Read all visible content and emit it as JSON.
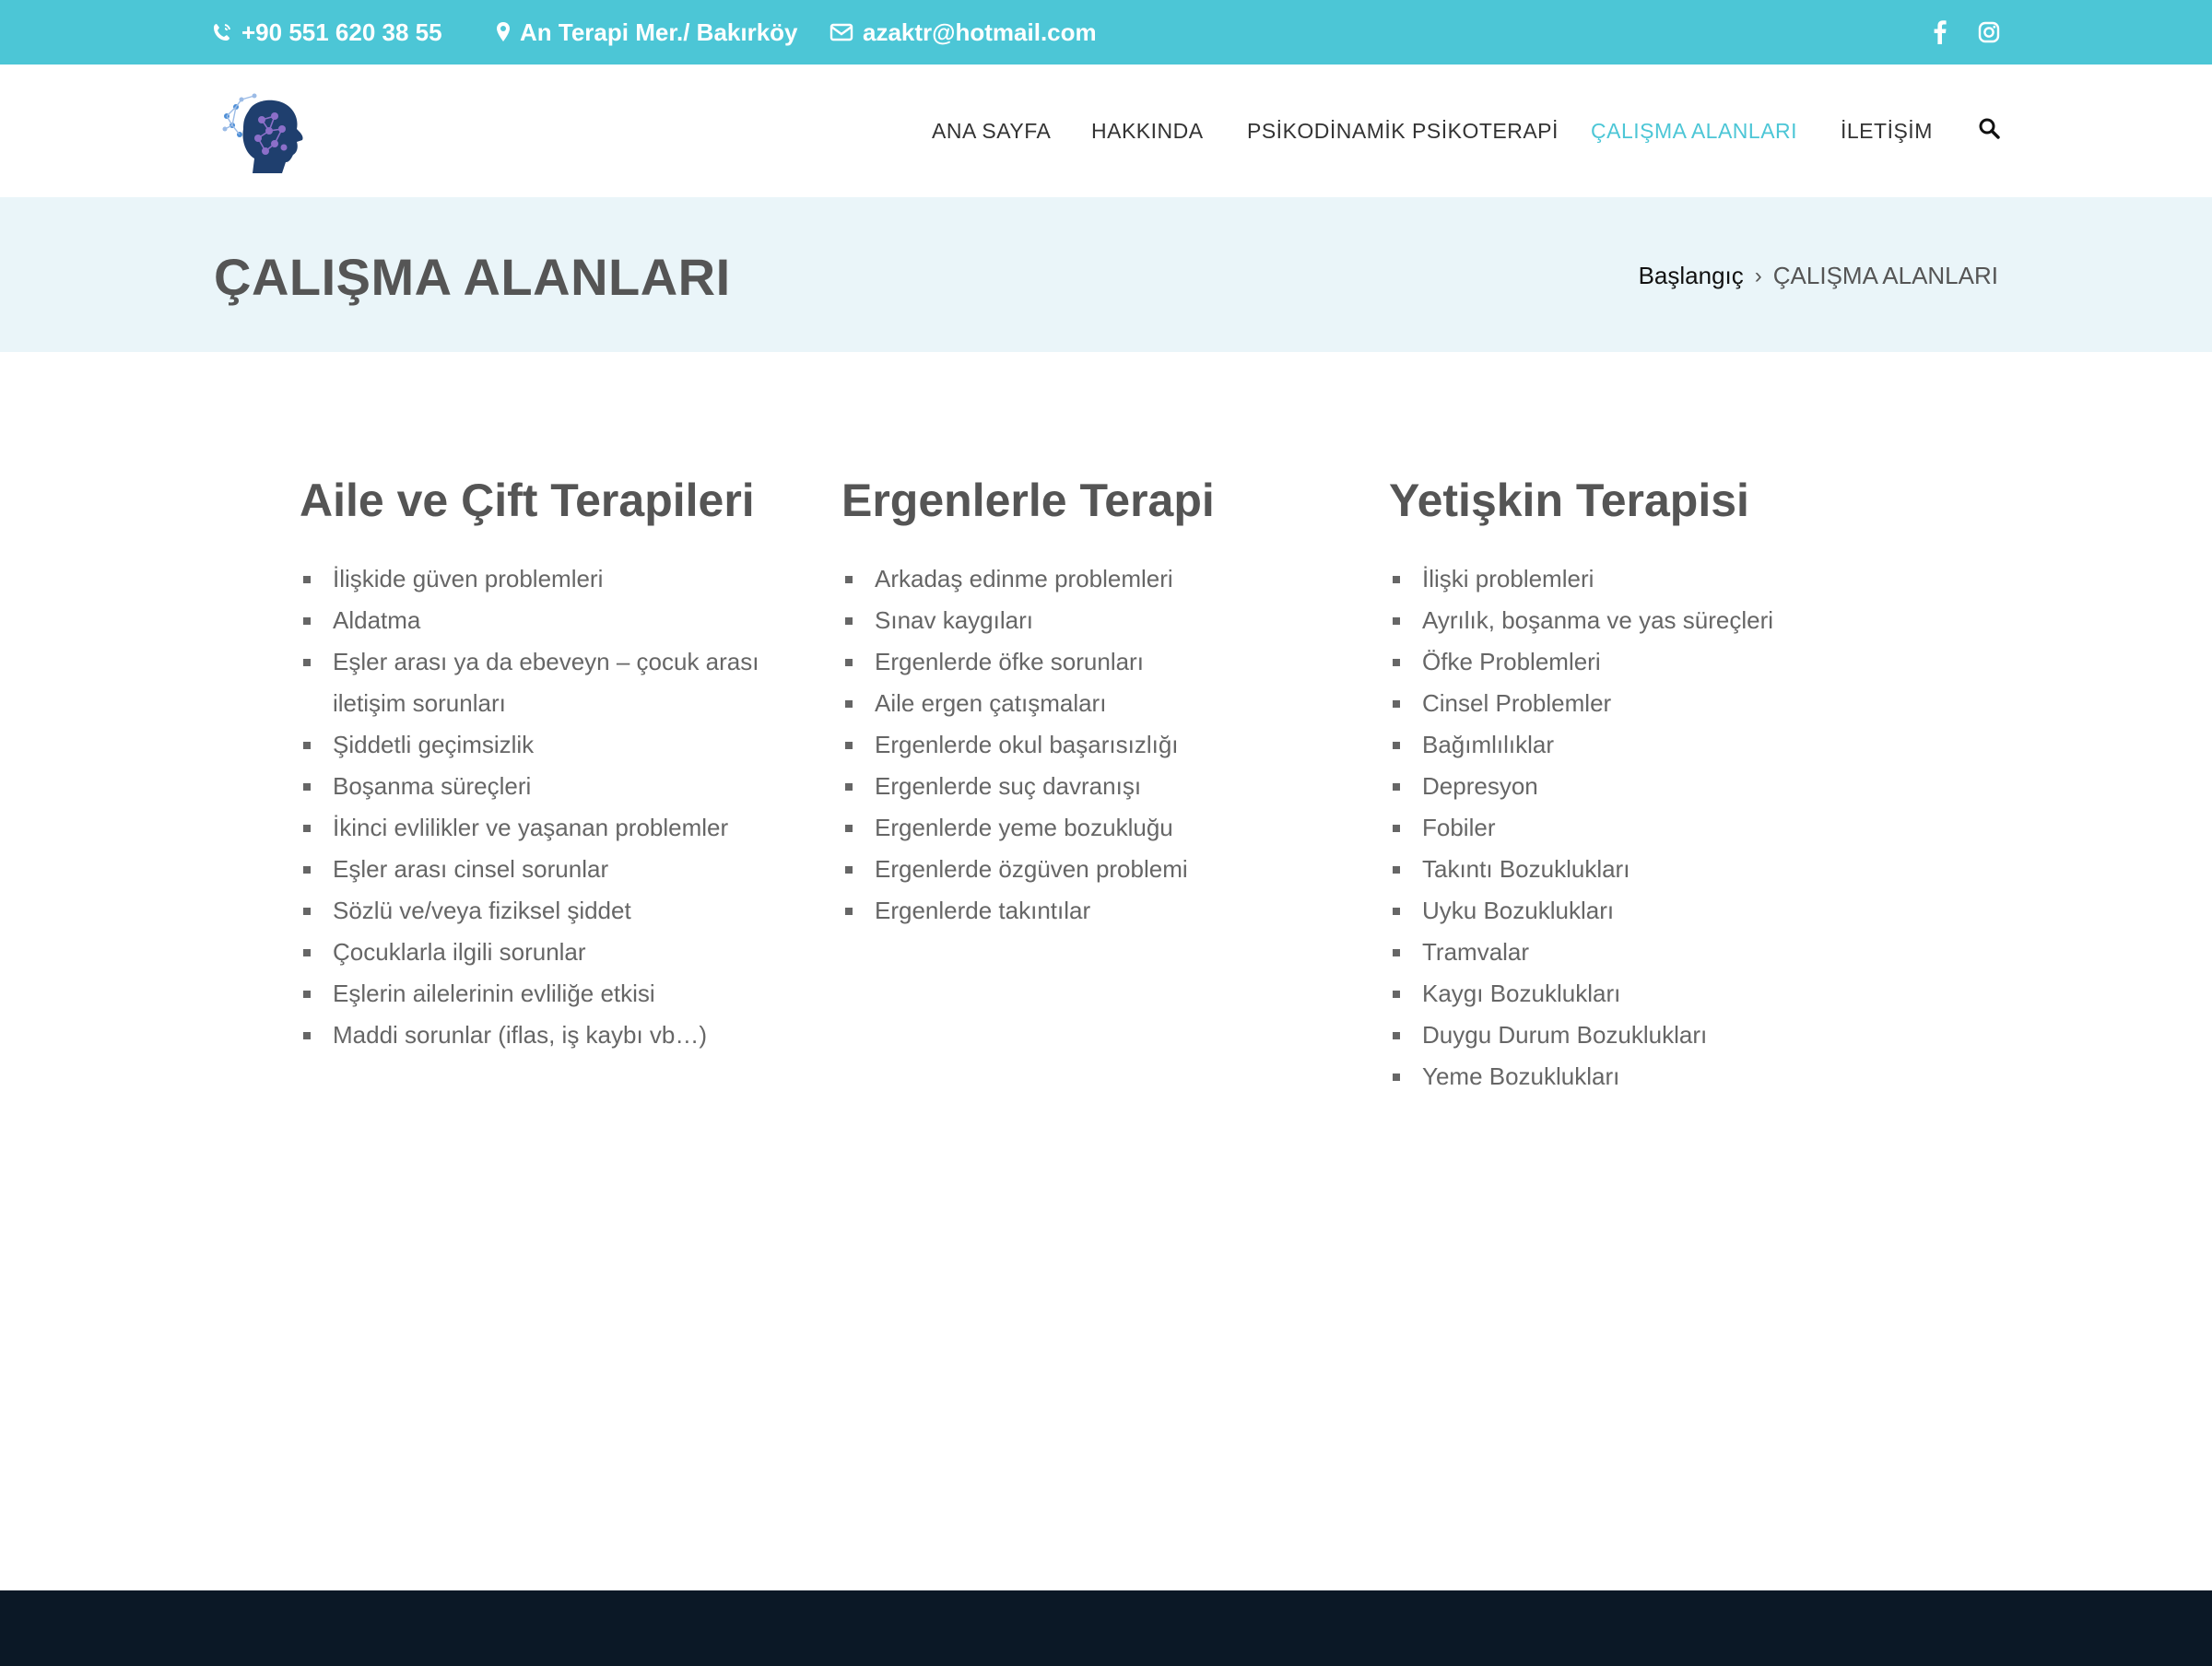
{
  "topbar": {
    "phone": "+90 551 620 38 55",
    "address": "An Terapi Mer./ Bakırköy",
    "email": "azaktr@hotmail.com",
    "social": [
      "facebook-icon",
      "instagram-icon"
    ],
    "bg_color": "#4cc6d6"
  },
  "nav": {
    "items": [
      {
        "label": "ANA SAYFA"
      },
      {
        "label": "HAKKINDA"
      },
      {
        "label": "PSİKODİNAMİK PSİKOTERAPİ"
      },
      {
        "label": "ÇALIŞMA ALANLARI",
        "active": true
      },
      {
        "label": "İLETİŞİM"
      }
    ],
    "active_color": "#4cc6d6"
  },
  "page": {
    "title": "ÇALIŞMA ALANLARI",
    "breadcrumb": {
      "home": "Başlangıç",
      "current": "ÇALIŞMA ALANLARI"
    }
  },
  "columns": [
    {
      "heading": "Aile ve Çift Terapileri",
      "items": [
        "İlişkide güven problemleri",
        "Aldatma",
        "Eşler arası ya da ebeveyn – çocuk arası iletişim sorunları",
        "Şiddetli geçimsizlik",
        "Boşanma süreçleri",
        "İkinci evlilikler ve yaşanan problemler",
        "Eşler arası cinsel sorunlar",
        "Sözlü ve/veya fiziksel şiddet",
        "Çocuklarla ilgili sorunlar",
        "Eşlerin ailelerinin evliliğe etkisi",
        "Maddi sorunlar (iflas, iş kaybı vb…)"
      ]
    },
    {
      "heading": "Ergenlerle Terapi",
      "items": [
        "Arkadaş edinme problemleri",
        "Sınav kaygıları",
        "Ergenlerde öfke sorunları",
        "Aile ergen çatışmaları",
        "Ergenlerde okul başarısızlığı",
        "Ergenlerde suç davranışı",
        "Ergenlerde yeme bozukluğu",
        "Ergenlerde özgüven problemi",
        "Ergenlerde takıntılar"
      ]
    },
    {
      "heading": "Yetişkin Terapisi",
      "items": [
        "İlişki problemleri",
        "Ayrılık, boşanma ve yas süreçleri",
        "Öfke Problemleri",
        "Cinsel Problemler",
        "Bağımlılıklar",
        "Depresyon",
        "Fobiler",
        "Takıntı Bozuklukları",
        "Uyku Bozuklukları",
        "Tramvalar",
        "Kaygı Bozuklukları",
        "Duygu Durum Bozuklukları",
        "Yeme Bozuklukları"
      ]
    }
  ],
  "footer": {
    "bg_color": "#0b1826"
  }
}
